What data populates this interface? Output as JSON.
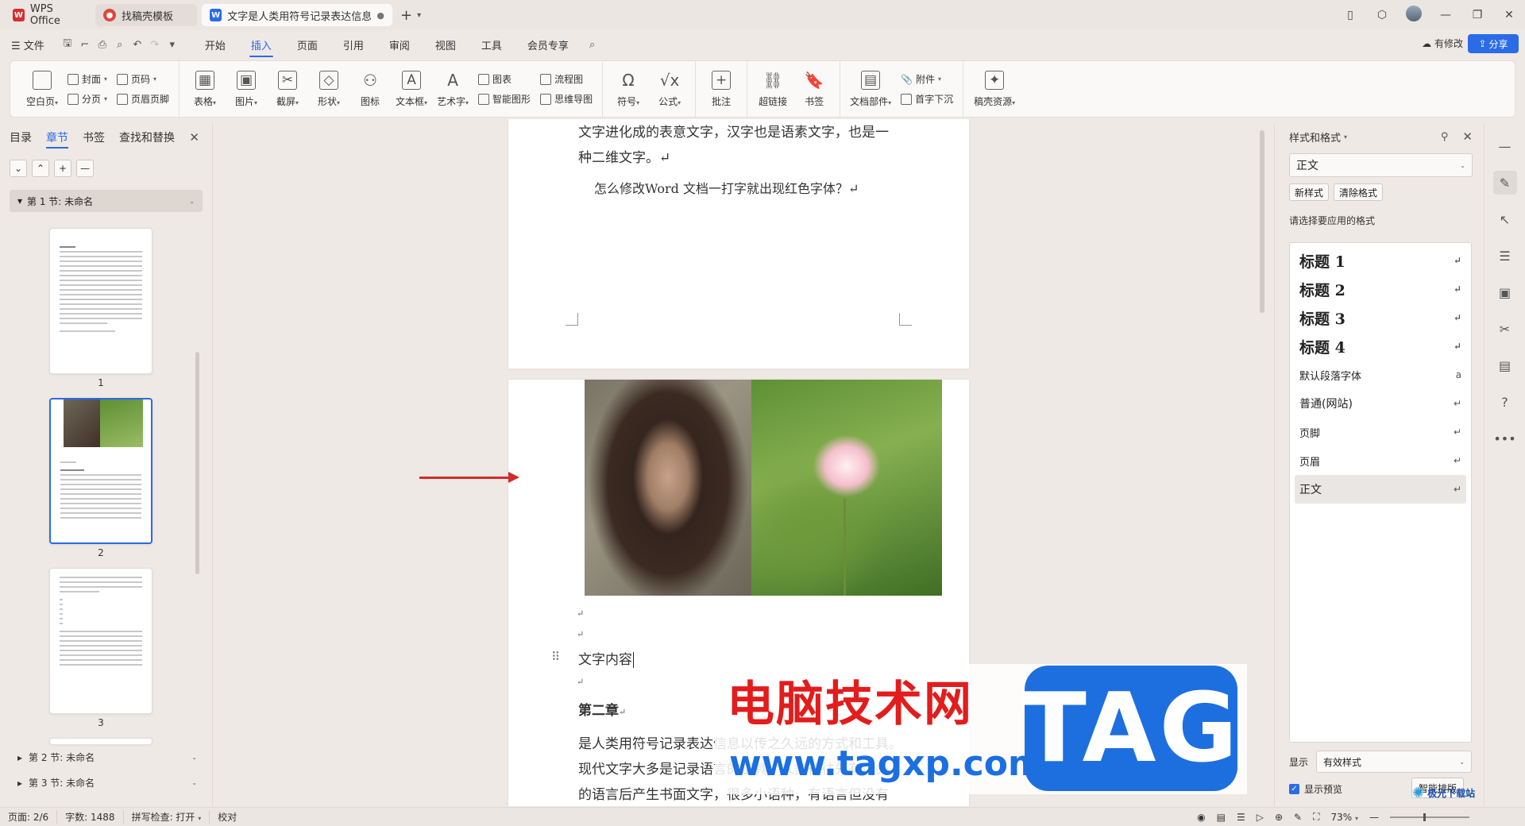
{
  "tabs": [
    {
      "label": "WPS Office"
    },
    {
      "label": "找稿壳模板"
    },
    {
      "label": "文字是人类用符号记录表达信息以"
    }
  ],
  "menubar": {
    "file": "文件",
    "menus": [
      "开始",
      "插入",
      "页面",
      "引用",
      "审阅",
      "视图",
      "工具",
      "会员专享"
    ],
    "active": "插入",
    "modified": "有修改",
    "share": "分享"
  },
  "ribbon": {
    "blank_page": "空白页",
    "cover": "封面",
    "section_break": "分页",
    "page_num": "页码",
    "header_footer": "页眉页脚",
    "table": "表格",
    "picture": "图片",
    "screenshot": "截屏",
    "shape": "形状",
    "icon": "图标",
    "textbox": "文本框",
    "wordart": "艺术字",
    "chart": "图表",
    "smartart": "智能图形",
    "flowchart": "流程图",
    "mindmap": "思维导图",
    "symbol": "符号",
    "formula": "公式",
    "comment": "批注",
    "hyperlink": "超链接",
    "bookmark": "书签",
    "doc_parts": "文档部件",
    "attachment": "附件",
    "drop_cap": "首字下沉",
    "resources": "稿壳资源"
  },
  "nav": {
    "tabs": [
      "目录",
      "章节",
      "书签",
      "查找和替换"
    ],
    "active": "章节",
    "section1": "第 1 节: 未命名",
    "section2": "第 2 节: 未命名",
    "section3": "第 3 节: 未命名",
    "pages": [
      "1",
      "2",
      "3"
    ]
  },
  "document": {
    "line1": "文字进化成的表意文字，汉字也是语素文字，也是一",
    "line2": "种二维文字。↵",
    "line3": "怎么修改Word 文档一打字就出现红色字体？↵",
    "para_mark": "↵",
    "content_text": "文字内容",
    "chapter": "第二章",
    "chapter_mark": "↵",
    "body1": "是人类用符号记录表达信息以传之久远的方式和工具。",
    "body2": "现代文字大多是记录语言的工具。人类往往先有口头",
    "body3": "的语言后产生书面文字，很多小语种，有语言但没有"
  },
  "watermark": {
    "cn": "电脑技术网",
    "url": "www.tagxp.com",
    "tag": "TAG",
    "corner": "极光下载站"
  },
  "stylepane": {
    "title": "样式和格式",
    "current": "正文",
    "new_style": "新样式",
    "clear_format": "清除格式",
    "prompt": "请选择要应用的格式",
    "items": [
      {
        "label": "标题  1",
        "kind": "h"
      },
      {
        "label": "标题  2",
        "kind": "h"
      },
      {
        "label": "标题  3",
        "kind": "h"
      },
      {
        "label": "标题  4",
        "kind": "h"
      },
      {
        "label": "默认段落字体",
        "kind": "s"
      },
      {
        "label": "普通(网站)",
        "kind": "n"
      },
      {
        "label": "页脚",
        "kind": "s"
      },
      {
        "label": "页眉",
        "kind": "s"
      },
      {
        "label": "正文",
        "kind": "n"
      }
    ],
    "selected": "正文",
    "show_label": "显示",
    "show_value": "有效样式",
    "preview": "显示预览",
    "smart_layout": "智能排版"
  },
  "status": {
    "page": "页面: 2/6",
    "words": "字数: 1488",
    "spell": "拼写检查: 打开",
    "proof": "校对",
    "zoom": "73%"
  },
  "colors": {
    "accent": "#2b6be6",
    "arrow": "#d42a2a",
    "wm_red": "#e31c1c",
    "wm_blue": "#1d6fe0"
  }
}
